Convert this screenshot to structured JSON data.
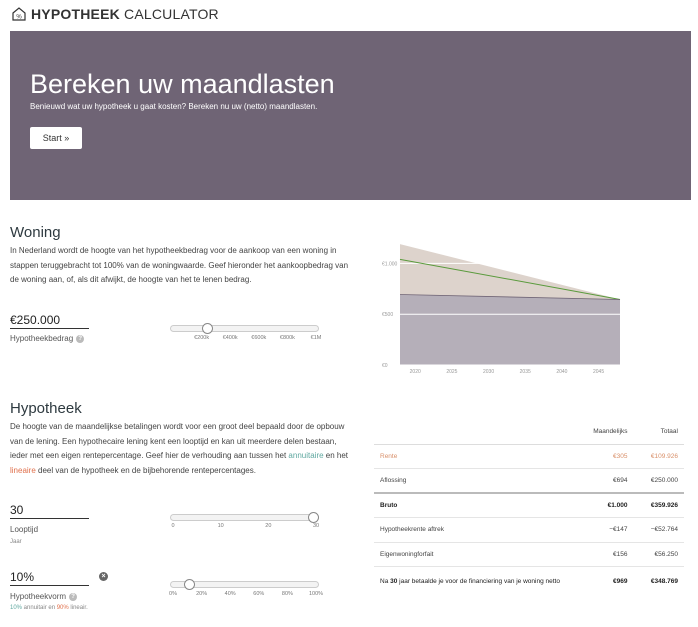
{
  "brand": {
    "name_bold": "HYPOTHEEK",
    "name_rest": " CALCULATOR"
  },
  "hero": {
    "title": "Bereken uw maandlasten",
    "subtitle": "Benieuwd wat uw hypotheek u gaat kosten? Bereken nu uw (netto) maandlasten.",
    "start_label": "Start »",
    "bg_color": "#6f6475"
  },
  "woning": {
    "heading": "Woning",
    "description": "In Nederland wordt de hoogte van het hypotheekbedrag voor de aankoop van een woning in stappen teruggebracht tot 100% van de woningwaarde. Geef hieronder het aankoopbedrag van de woning aan, of, als dit afwijkt, de hoogte van het te lenen bedrag.",
    "amount_value": "€250.000",
    "amount_label": "Hypotheekbedrag",
    "help": "?",
    "slider_value_fraction": 0.23,
    "slider_ticks": [
      "€200k",
      "€400k",
      "€600k",
      "€800k",
      "€1M"
    ]
  },
  "chart": {
    "y_ticks": [
      "€1.000",
      "€500",
      "€0"
    ],
    "x_ticks": [
      "2020",
      "2025",
      "2030",
      "2035",
      "2040",
      "2045"
    ]
  },
  "chart_data": {
    "type": "area",
    "x": [
      2018,
      2048
    ],
    "ylim": [
      0,
      1250
    ],
    "series": [
      {
        "values": [
          1190,
          645
        ],
        "color": "#ddd3cc"
      },
      {
        "values": [
          694,
          645
        ],
        "color": "#b5afb9"
      },
      {
        "values": [
          1040,
          645
        ],
        "color": "#5a9a3c"
      }
    ],
    "y_tick_values": [
      1000,
      500,
      0
    ],
    "x_tick_values": [
      2020,
      2025,
      2030,
      2035,
      2040,
      2045
    ],
    "grid": true
  },
  "hypotheek": {
    "heading": "Hypotheek",
    "desc_1": "De hoogte van de maandelijkse betalingen wordt voor een groot deel bepaald door de opbouw van de lening. Een hypothecaire lening kent een looptijd en kan uit meerdere delen bestaan, ieder met een eigen rentepercentage. Geef hier de verhouding aan tussen het ",
    "desc_ann": "annuitaire",
    "desc_2": " en het ",
    "desc_lin": "lineaire",
    "desc_3": " deel van de hypotheek en de bijbehorende rentepercentages.",
    "term_value": "30",
    "term_label": "Looptijd",
    "term_unit": "Jaar",
    "term_slider_fraction": 1.0,
    "term_ticks": [
      "0",
      "10",
      "20",
      "30"
    ],
    "form_value": "10%",
    "form_label": "Hypotheekvorm",
    "form_close": "×",
    "form_sub_ann": "10%",
    "form_sub_ann_text": " annuitair en ",
    "form_sub_lin": "90%",
    "form_sub_lin_text": " lineair.",
    "form_slider_fraction": 0.1,
    "form_ticks": [
      "0%",
      "20%",
      "40%",
      "60%",
      "80%",
      "100%"
    ]
  },
  "results": {
    "col_monthly": "Maandelijks",
    "col_total": "Totaal",
    "rows": [
      {
        "label": "Rente",
        "monthly": "€305",
        "total": "€109.926"
      },
      {
        "label": "Aflossing",
        "monthly": "€694",
        "total": "€250.000"
      },
      {
        "label": "Bruto",
        "monthly": "€1.000",
        "total": "€359.926"
      },
      {
        "label": "Hypotheekrente aftrek",
        "monthly": "−€147",
        "total": "−€52.764"
      },
      {
        "label": "Eigenwoningforfait",
        "monthly": "€156",
        "total": "€56.250"
      }
    ],
    "net_pre": "Na ",
    "net_years": "30",
    "net_post": " jaar betaalde je voor de financiering van je woning netto",
    "net_monthly": "€969",
    "net_total": "€348.769"
  }
}
